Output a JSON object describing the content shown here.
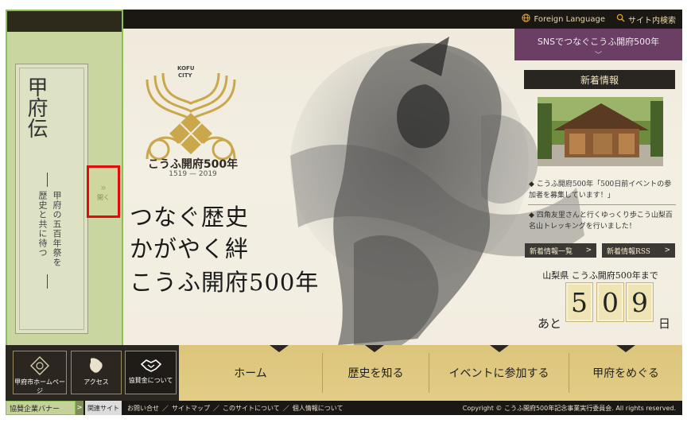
{
  "topbar": {
    "foreign_language": "Foreign Language",
    "site_search": "サイト内検索"
  },
  "sidebar": {
    "title": "甲府伝",
    "subtitle_line1": "甲府の五百年祭を",
    "subtitle_line2": "歴史と共に待つ",
    "open_label": "開く"
  },
  "logo": {
    "kofu": "KOFU",
    "city": "CITY",
    "name": "こうふ開府500年",
    "years": "1519 — 2019"
  },
  "catch": {
    "line1": "つなぐ歴史",
    "line2": "かがやく絆",
    "line3": "こうふ開府500年"
  },
  "sns": {
    "label": "SNSでつなぐこうふ開府500年",
    "arrow": "﹀"
  },
  "news": {
    "title": "新着情報",
    "items": [
      "こうふ開府500年「500日前イベントの参加者を募集しています！」",
      "四角友里さんと行くゆっくり歩こう山梨百名山トレッキングを行いました！"
    ],
    "list_button": "新着情報一覧",
    "rss_button": "新着情報RSS"
  },
  "countdown": {
    "label": "山梨県 こうふ開府500年まで",
    "prefix": "あと",
    "digits": [
      "5",
      "0",
      "9"
    ],
    "suffix": "日"
  },
  "quick": {
    "homepage": "甲府市ホームページ",
    "access": "アクセス",
    "kyosan": "協賛金について"
  },
  "nav": [
    "ホーム",
    "歴史を知る",
    "イベントに参加する",
    "甲府をめぐる"
  ],
  "footer": {
    "banner": "協賛企業バナー",
    "banner_arrow": ">",
    "related": "関連サイト",
    "links": [
      "お問い合せ",
      "サイトマップ",
      "このサイトについて",
      "個人情報について"
    ],
    "separator": "／",
    "copyright": "Copyright © こうふ開府500年記念事業実行委員会. All rights reserved."
  },
  "colors": {
    "accent_purple": "#6b3e64",
    "gold": "#dcc57b",
    "dark": "#2b2620",
    "sidebar_green": "#c9d6a0",
    "highlight_red": "#e10d0d"
  }
}
